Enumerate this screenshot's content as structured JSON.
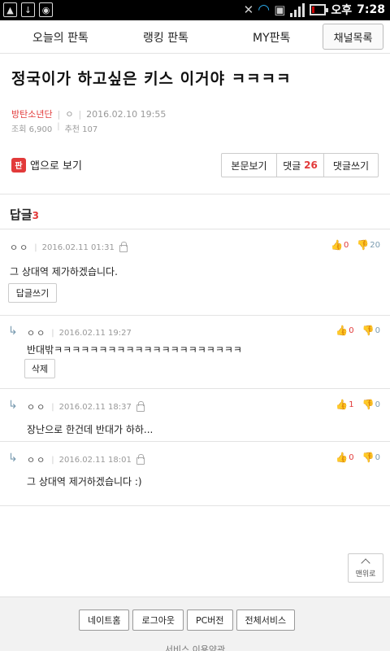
{
  "status_bar": {
    "time": "7:28",
    "ampm": "오후",
    "left_icons": [
      "image-icon",
      "download-icon",
      "camera-icon"
    ],
    "battery_level": 0.2
  },
  "topnav": {
    "items": [
      "오늘의 판톡",
      "랭킹 판톡",
      "MY판톡"
    ],
    "channel_button": "채널목록"
  },
  "post": {
    "title": "정국이가 하고싶은 키스 이거야 ㅋㅋㅋㅋ",
    "board": "방탄소년단",
    "author": "ㅇ",
    "datetime": "2016.02.10 19:55",
    "views": "조회 6,900",
    "recommends": "추천 107"
  },
  "actions": {
    "app_view": "앱으로 보기",
    "app_icon_text": "판",
    "view_body": "본문보기",
    "comments_label": "댓글",
    "comments_count": "26",
    "write_comment": "댓글쓰기"
  },
  "replies": {
    "header": "답글",
    "count": "3"
  },
  "comments": [
    {
      "author": "ㅇㅇ",
      "date": "2016.02.11 01:31",
      "up": "0",
      "down": "20",
      "text": "그 상대역 제가하겠습니다.",
      "button": "답글쓰기"
    },
    {
      "author": "ㅇㅇ",
      "date": "2016.02.11 19:27",
      "up": "0",
      "down": "0",
      "text": "반대밖ㅋㅋㅋㅋㅋㅋㅋㅋㅋㅋㅋㅋㅋㅋㅋㅋㅋㅋㅋㅋㅋ",
      "button": "삭제"
    },
    {
      "author": "ㅇㅇ",
      "date": "2016.02.11 18:37",
      "up": "1",
      "down": "0",
      "text": "장난으로 한건데 반대가 하하..."
    },
    {
      "author": "ㅇㅇ",
      "date": "2016.02.11 18:01",
      "up": "0",
      "down": "0",
      "text": "그 상대역 제거하겠습니다 :)"
    }
  ],
  "top_button": "맨위로",
  "footer": {
    "buttons": [
      "네이트홈",
      "로그아웃",
      "PC버전",
      "전체서비스"
    ],
    "link": "서비스 이용약관"
  }
}
